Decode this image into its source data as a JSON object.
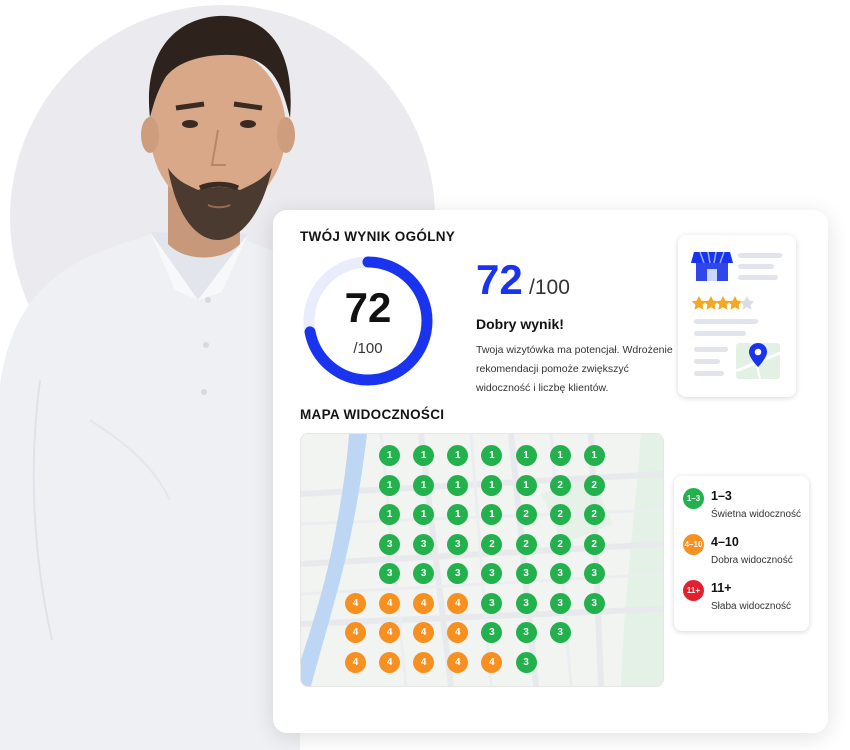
{
  "score": {
    "section_title": "TWÓJ WYNIK OGÓLNY",
    "value": 72,
    "value_label": "72",
    "max_label": "/100",
    "progress_fraction": 0.72,
    "verdict": "Dobry wynik!",
    "description": "Twoja wizytówka ma potencjał. Wdrożenie rekomendacji pomoże zwiększyć widoczność i liczbę klientów.",
    "ring_color": "#1a33ee",
    "ring_track_color": "#e8ecfb"
  },
  "business_card": {
    "rating_filled_stars": 4,
    "rating_total_stars": 5,
    "star_color": "#f5a623",
    "icons": [
      "store-icon",
      "map-pin-icon"
    ]
  },
  "visibility_map": {
    "section_title": "MAPA WIDOCZNOŚCI",
    "rows": [
      [
        "",
        "1",
        "1",
        "1",
        "1",
        "1",
        "1",
        "1"
      ],
      [
        "",
        "1",
        "1",
        "1",
        "1",
        "1",
        "2",
        "2"
      ],
      [
        "",
        "1",
        "1",
        "1",
        "1",
        "2",
        "2",
        "2"
      ],
      [
        "",
        "3",
        "3",
        "3",
        "2",
        "2",
        "2",
        "2"
      ],
      [
        "",
        "3",
        "3",
        "3",
        "3",
        "3",
        "3",
        "3"
      ],
      [
        "4",
        "4",
        "4",
        "4",
        "3",
        "3",
        "3",
        "3"
      ],
      [
        "4",
        "4",
        "4",
        "4",
        "3",
        "3",
        "3",
        ""
      ],
      [
        "4",
        "4",
        "4",
        "4",
        "4",
        "3",
        "",
        ""
      ]
    ]
  },
  "legend": [
    {
      "badge": "1–3",
      "range": "1–3",
      "label": "Świetna widoczność",
      "color": "#22b14c"
    },
    {
      "badge": "4–10",
      "range": "4–10",
      "label": "Dobra widoczność",
      "color": "#f7901e"
    },
    {
      "badge": "11+",
      "range": "11+",
      "label": "Słaba widoczność",
      "color": "#e5202e"
    }
  ]
}
